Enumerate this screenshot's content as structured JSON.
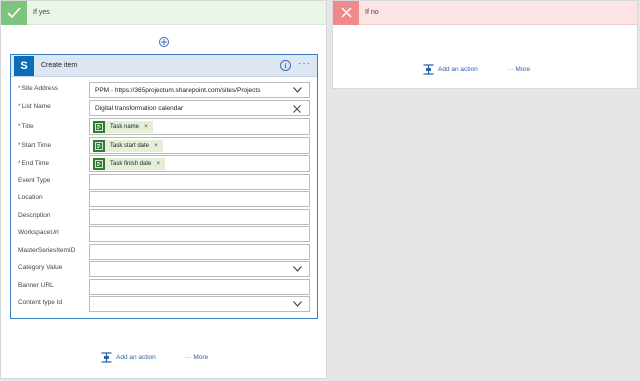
{
  "yes_branch": {
    "title": "If yes"
  },
  "no_branch": {
    "title": "If no"
  },
  "card": {
    "title": "Create item",
    "fields": {
      "site_address": {
        "label": "Site Address",
        "value": "PPM - https://365projectum.sharepoint.com/sites/Projects"
      },
      "list_name": {
        "label": "List Name",
        "value": "Digital transformation calendar"
      },
      "title": {
        "label": "Title",
        "token": "Task name"
      },
      "start_time": {
        "label": "Start Time",
        "token": "Task start date"
      },
      "end_time": {
        "label": "End Time",
        "token": "Task finish date"
      },
      "event_type": {
        "label": "Event Type",
        "value": ""
      },
      "location": {
        "label": "Location",
        "value": ""
      },
      "description": {
        "label": "Description",
        "value": ""
      },
      "workspace_url": {
        "label": "WorkspaceUrl",
        "value": ""
      },
      "master_series": {
        "label": "MasterSeriesItemID",
        "value": ""
      },
      "category_value": {
        "label": "Category Value",
        "value": ""
      },
      "banner_url": {
        "label": "Banner URL",
        "value": ""
      },
      "content_type": {
        "label": "Content type Id",
        "value": ""
      }
    }
  },
  "actions": {
    "add_action": "Add an action",
    "more": "More"
  }
}
